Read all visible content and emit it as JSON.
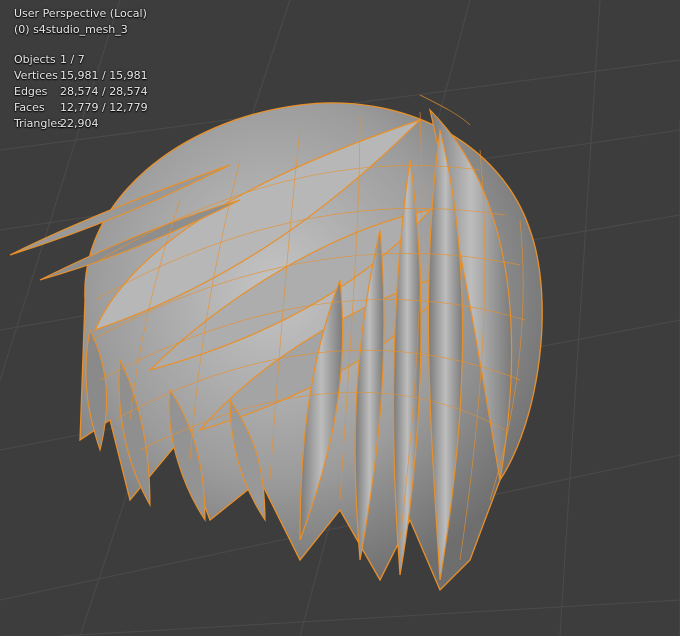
{
  "viewport": {
    "perspective_label": "User Perspective (Local)",
    "object_label": "(0) s4studio_mesh_3"
  },
  "stats": [
    {
      "label": "Objects",
      "value": "1 / 7"
    },
    {
      "label": "Vertices",
      "value": "15,981 / 15,981"
    },
    {
      "label": "Edges",
      "value": "28,574 / 28,574"
    },
    {
      "label": "Faces",
      "value": "12,779 / 12,779"
    },
    {
      "label": "Triangles",
      "value": "22,904"
    }
  ],
  "colors": {
    "background": "#3d3d3d",
    "grid": "#4a4a4a",
    "mesh_fill": "#9a9a9a",
    "wireframe": "#e8902a"
  }
}
